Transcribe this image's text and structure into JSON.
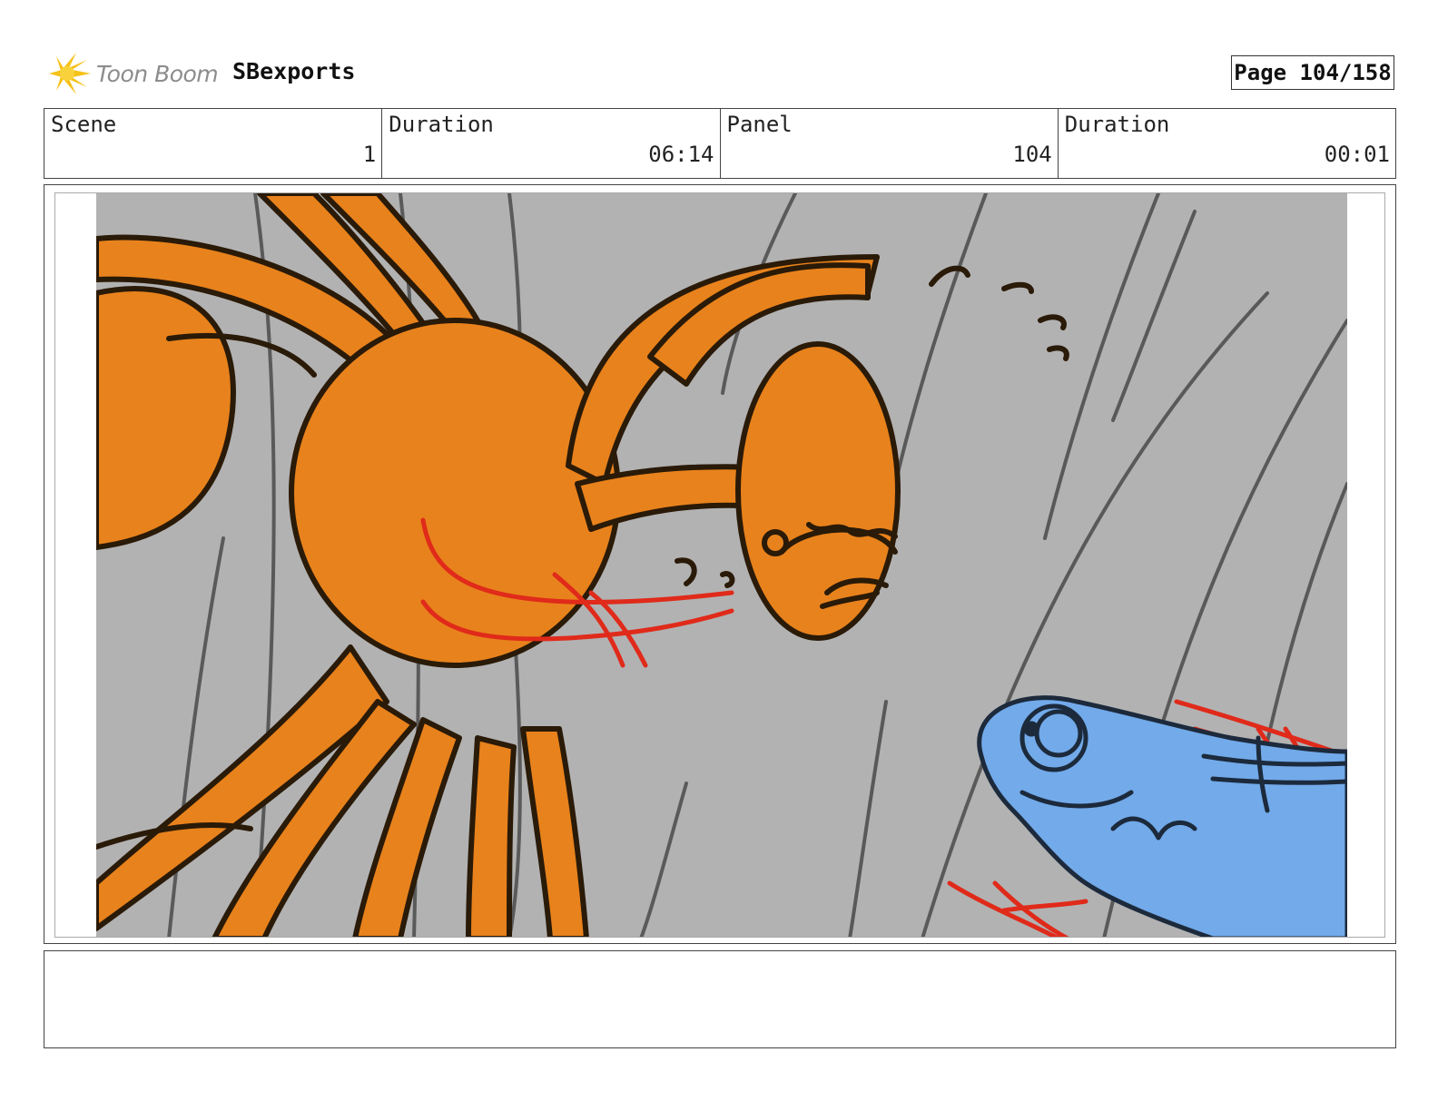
{
  "header": {
    "logo_text": "Toon Boom",
    "project": "SBexports",
    "page": "Page 104/158"
  },
  "info": {
    "scene_label": "Scene",
    "scene_value": "1",
    "scene_duration_label": "Duration",
    "scene_duration_value": "06:14",
    "panel_label": "Panel",
    "panel_value": "104",
    "panel_duration_label": "Duration",
    "panel_duration_value": "00:01"
  },
  "colors": {
    "background": "#b2b2b2",
    "orange": "#e8821c",
    "blue": "#72aaea",
    "ink": "#2a1a08",
    "action_red": "#e02a1a"
  },
  "icons": {
    "logo": "toon-boom-sunburst-icon"
  },
  "notes": ""
}
